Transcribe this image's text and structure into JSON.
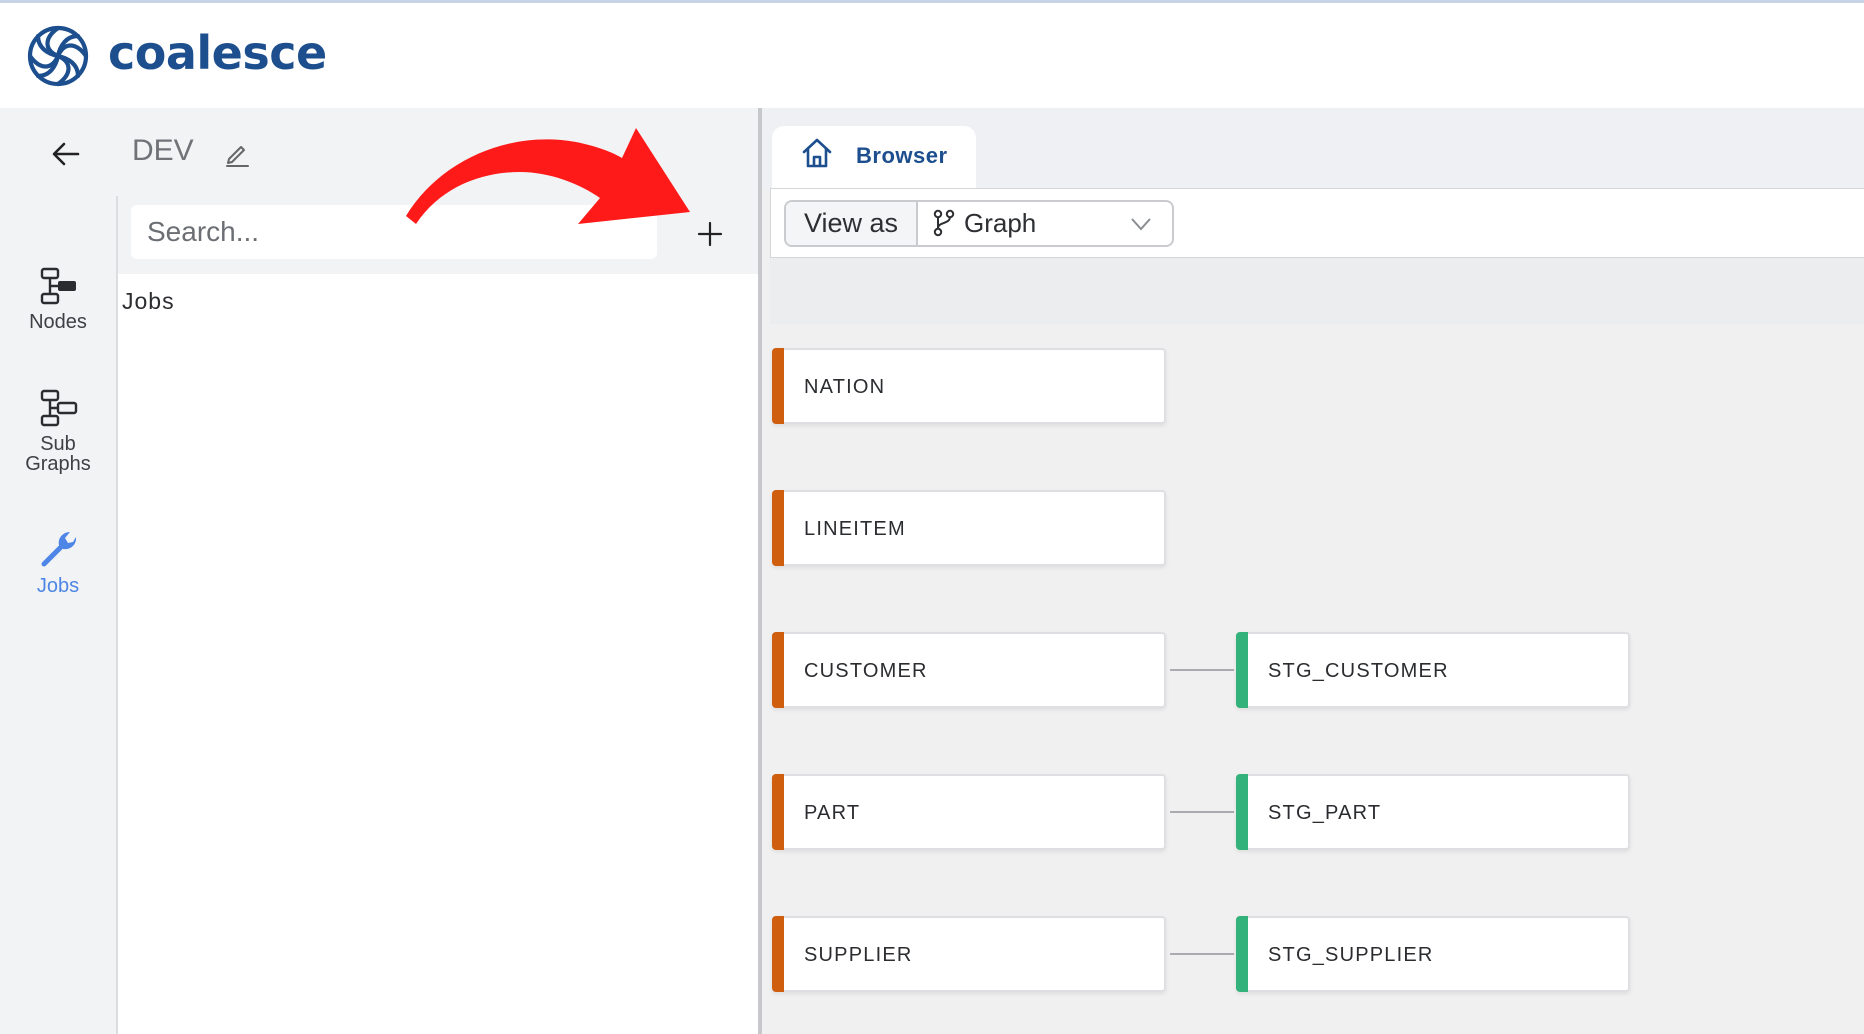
{
  "app": {
    "logo_text": "coalesce",
    "brand_color": "#1d4f8f",
    "accent_color": "#4d86e6"
  },
  "header": {
    "environment": "DEV",
    "back_icon": "arrow-left-icon",
    "edit_icon": "pencil-icon"
  },
  "rail": {
    "items": [
      {
        "label": "Nodes",
        "icon": "nodes-icon",
        "active": false
      },
      {
        "label": "Sub\nGraphs",
        "label_line1": "Sub",
        "label_line2": "Graphs",
        "icon": "subgraphs-icon",
        "active": false
      },
      {
        "label": "Jobs",
        "icon": "wrench-icon",
        "active": true
      }
    ]
  },
  "sidebar": {
    "search_placeholder": "Search...",
    "add_icon": "plus-icon",
    "section_heading": "Jobs"
  },
  "main": {
    "tab": {
      "label": "Browser",
      "icon": "home-icon"
    },
    "toolbar": {
      "view_as_label": "View as",
      "view_mode": "Graph",
      "view_mode_icon": "git-branch-icon"
    },
    "graph": {
      "source_color": "#cf5f0f",
      "stage_color": "#34b27b",
      "rows": [
        {
          "source": "NATION",
          "stage": null
        },
        {
          "source": "LINEITEM",
          "stage": null
        },
        {
          "source": "CUSTOMER",
          "stage": "STG_CUSTOMER"
        },
        {
          "source": "PART",
          "stage": "STG_PART"
        },
        {
          "source": "SUPPLIER",
          "stage": "STG_SUPPLIER"
        }
      ]
    }
  },
  "annotation": {
    "arrow_color": "#ff1a1a"
  }
}
